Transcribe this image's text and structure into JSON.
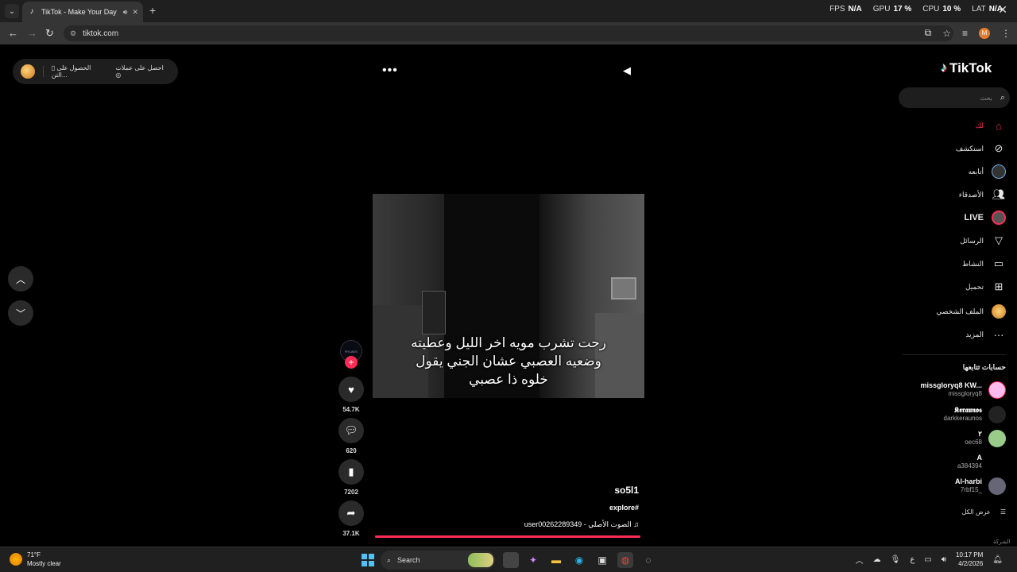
{
  "browser": {
    "tab_title": "TikTok - Make Your Day",
    "url": "tiktok.com",
    "profile_initial": "M",
    "perf": [
      {
        "label": "FPS",
        "value": "N/A"
      },
      {
        "label": "GPU",
        "value": "17 %"
      },
      {
        "label": "CPU",
        "value": "10 %"
      },
      {
        "label": "LAT",
        "value": "N/A"
      }
    ]
  },
  "topbar": {
    "get_coins": "احصل على عملات",
    "get_app": "الحصول على التن..."
  },
  "video": {
    "caption_lines": [
      "رحت تشرب مويه اخر الليل وعطيته",
      "وضعيه العصبي عشان الجني يقول",
      "خلوه ذا عصبي"
    ],
    "creator_badge": "RYLAKS",
    "likes": "54.7K",
    "comments": "620",
    "saves": "7202",
    "shares": "37.1K",
    "author": "so5l1",
    "hashtag": "explore#",
    "music": "user00262289349 - الصوت الأصلي",
    "progress_fraction": 1.0
  },
  "sidebar": {
    "logo": "TikTok",
    "search_placeholder": "بحث",
    "menu": [
      {
        "label": "لك",
        "icon": "home-icon",
        "active": true
      },
      {
        "label": "استكشف",
        "icon": "compass-icon",
        "active": false
      },
      {
        "label": "أتابعه",
        "icon": "following-icon",
        "active": false
      },
      {
        "label": "الأصدقاء",
        "icon": "friends-icon",
        "active": false
      },
      {
        "label": "LIVE",
        "icon": "live-icon",
        "active": false
      },
      {
        "label": "الرسائل",
        "icon": "messages-icon",
        "active": false
      },
      {
        "label": "النشاط",
        "icon": "activity-icon",
        "active": false
      },
      {
        "label": "تحميل",
        "icon": "upload-icon",
        "active": false
      },
      {
        "label": "الملف الشخصي",
        "icon": "profile-icon",
        "active": false
      },
      {
        "label": "المزيد",
        "icon": "more-icon",
        "active": false
      }
    ],
    "following_title": "حسابات تتابعها",
    "accounts": [
      {
        "name": "missgloryq8 KW...",
        "username": "missgloryq8"
      },
      {
        "name": "𝕶𝖊𝖗𝖆𝖚𝖓𝖔𝖘",
        "username": "darkkeraunos"
      },
      {
        "name": "٢",
        "username": "oec68"
      },
      {
        "name": "A",
        "username": "a384394"
      },
      {
        "name": "Al-harbi",
        "username": "7rbf15_"
      }
    ],
    "see_all": "عرض الكل",
    "company": "الشركة"
  },
  "taskbar": {
    "temp": "71°F",
    "condition": "Mostly clear",
    "search": "Search",
    "time": "10:17 PM",
    "date": "4/2/2026",
    "lang": "ع"
  },
  "colors": {
    "accent": "#fe2c55",
    "browser_dark": "#1f1f1f"
  }
}
